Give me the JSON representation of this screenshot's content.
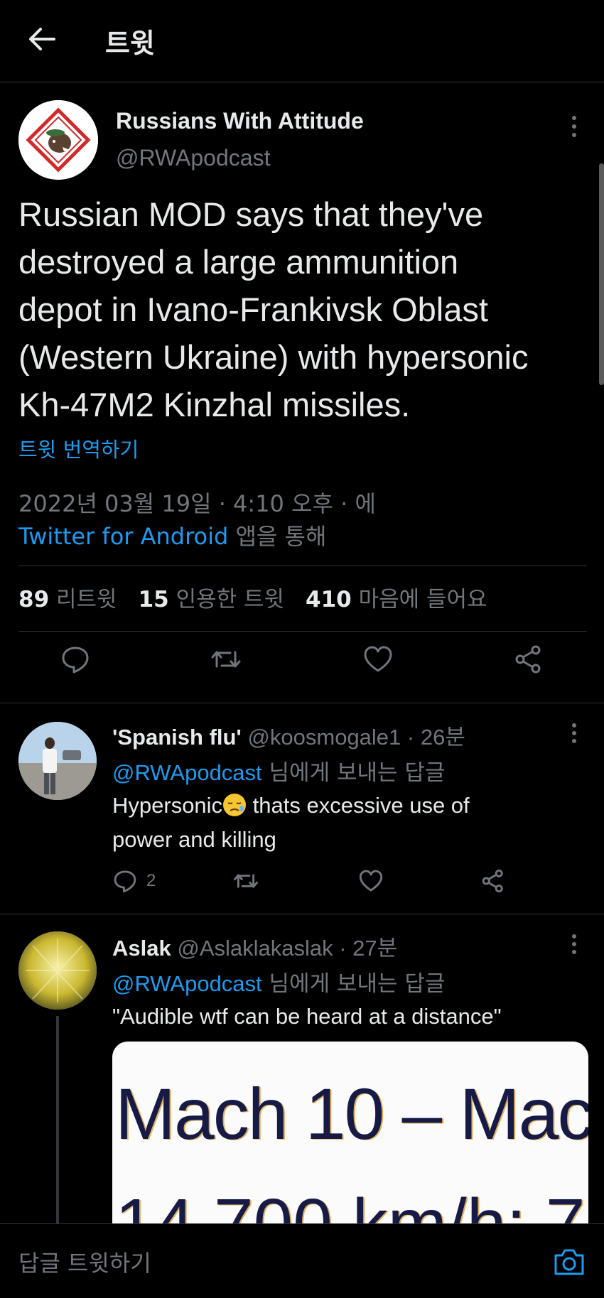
{
  "header": {
    "title": "트윗",
    "back_icon": "arrow-left-icon"
  },
  "tweet": {
    "author_name": "Russians With Attitude",
    "author_handle": "@RWApodcast",
    "text_lines": [
      "Russian MOD says that they've",
      "destroyed a large ammunition",
      "depot in Ivano-Frankivsk Oblast",
      "(Western Ukraine) with hypersonic",
      "Kh-47M2 Kinzhal missiles."
    ],
    "translate_label": "트윗 번역하기",
    "date": "2022년 03월 19일 · 4:10 오후 · 에",
    "source_app": "Twitter for Android",
    "source_suffix": " 앱을 통해",
    "stats": {
      "retweets_count": "89",
      "retweets_label": "리트윗",
      "quotes_count": "15",
      "quotes_label": "인용한 트윗",
      "likes_count": "410",
      "likes_label": "마음에 들어요"
    }
  },
  "replies": [
    {
      "name": "'Spanish flu'",
      "handle_time": " @koosmogale1 · 26분",
      "reply_to_handle": "@RWApodcast",
      "reply_to_suffix": " 님에게 보내는 답글",
      "text_line1_a": "Hypersonic",
      "text_line1_b": " thats excessive use of",
      "text_line2": "power and killing",
      "reply_count": "2"
    },
    {
      "name": "Aslak",
      "handle_time": " @Aslaklakaslak · 27분",
      "reply_to_handle": "@RWApodcast",
      "reply_to_suffix": " 님에게 보내는 답글",
      "text": "\"Audible wtf can be heard at a distance\"",
      "media_text_line1": "Mach 10 – Mac",
      "media_text_line2": "14,700 km/h; 7"
    }
  ],
  "compose": {
    "placeholder": "답글 트윗하기"
  },
  "colors": {
    "background": "#000000",
    "text": "#e7e9ea",
    "secondary": "#71767b",
    "accent": "#1d9bf0",
    "divider": "#2f3336"
  }
}
